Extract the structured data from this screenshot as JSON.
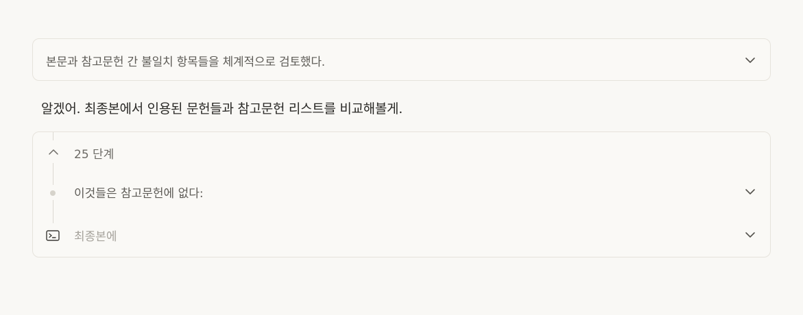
{
  "summary": {
    "text": "본문과 참고문헌 간 불일치 항목들을 체계적으로 검토했다.",
    "toggle_icon": "chevron-down-icon"
  },
  "response": {
    "text": "알겠어. 최종본에서 인용된 문헌들과 참고문헌 리스트를 비교해볼게."
  },
  "steps": {
    "count_label": "25 단계",
    "collapse_icon": "chevron-up-icon",
    "items": [
      {
        "text": "이것들은 참고문헌에 없다:",
        "icon": "dot-icon",
        "toggle_icon": "chevron-down-icon"
      },
      {
        "text": "최종본에",
        "icon": "terminal-icon",
        "toggle_icon": "chevron-down-icon"
      }
    ]
  },
  "colors": {
    "background": "#f9f8f5",
    "card_border": "#e6e3dc",
    "primary_text": "#2a2926",
    "secondary_text": "#5e5c57",
    "muted_text": "#a5a29b"
  }
}
